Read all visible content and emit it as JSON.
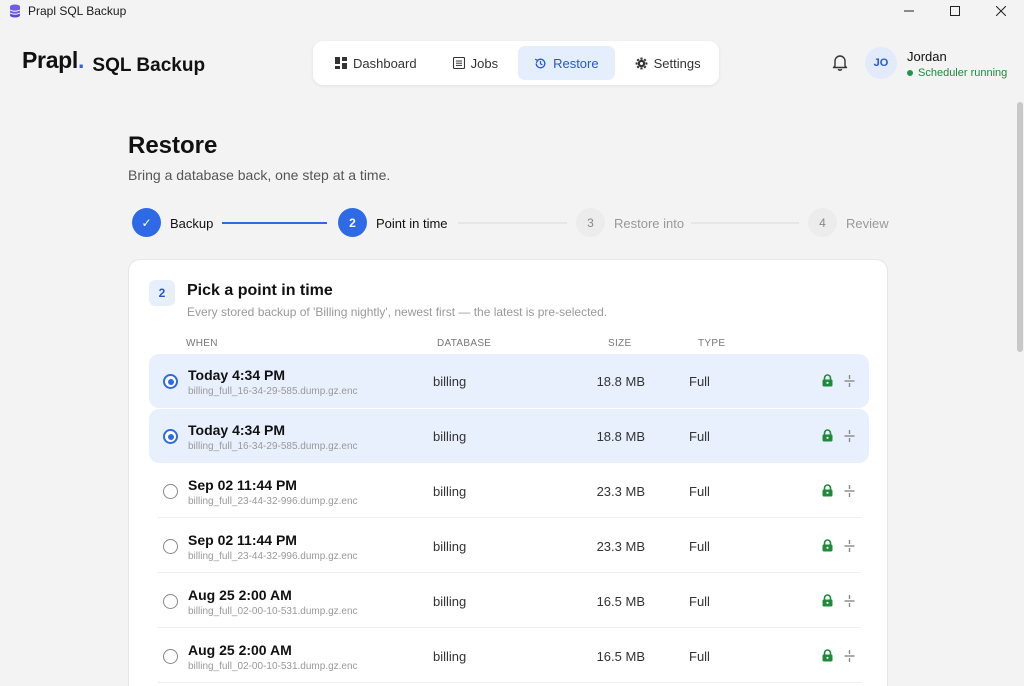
{
  "window": {
    "title": "Prapl SQL Backup"
  },
  "brand": {
    "name": "Prapl",
    "dot": ".",
    "product": "SQL Backup"
  },
  "nav": [
    {
      "label": "Dashboard",
      "icon": "dashboard-icon"
    },
    {
      "label": "Jobs",
      "icon": "jobs-icon"
    },
    {
      "label": "Restore",
      "icon": "restore-icon",
      "active": true
    },
    {
      "label": "Settings",
      "icon": "gear-icon"
    }
  ],
  "user": {
    "initials": "JO",
    "name": "Jordan",
    "status": "Scheduler running"
  },
  "page": {
    "title": "Restore",
    "subtitle": "Bring a database back, one step at a time."
  },
  "steps": [
    {
      "mark": "✓",
      "label": "Backup",
      "state": "done"
    },
    {
      "mark": "2",
      "label": "Point in time",
      "state": "current"
    },
    {
      "mark": "3",
      "label": "Restore into",
      "state": "todo"
    },
    {
      "mark": "4",
      "label": "Review",
      "state": "todo"
    }
  ],
  "card": {
    "badge": "2",
    "title": "Pick a point in time",
    "subtitle": "Every stored backup of 'Billing nightly', newest first — the latest is pre-selected.",
    "columns": {
      "when": "WHEN",
      "database": "DATABASE",
      "size": "SIZE",
      "type": "TYPE"
    },
    "rows": [
      {
        "when": "Today 4:34 PM",
        "file": "billing_full_16-34-29-585.dump.gz.enc",
        "database": "billing",
        "size": "18.8 MB",
        "type": "Full",
        "selected": true
      },
      {
        "when": "Today 4:34 PM",
        "file": "billing_full_16-34-29-585.dump.gz.enc",
        "database": "billing",
        "size": "18.8 MB",
        "type": "Full",
        "selected": true
      },
      {
        "when": "Sep 02 11:44 PM",
        "file": "billing_full_23-44-32-996.dump.gz.enc",
        "database": "billing",
        "size": "23.3 MB",
        "type": "Full",
        "selected": false
      },
      {
        "when": "Sep 02 11:44 PM",
        "file": "billing_full_23-44-32-996.dump.gz.enc",
        "database": "billing",
        "size": "23.3 MB",
        "type": "Full",
        "selected": false
      },
      {
        "when": "Aug 25 2:00 AM",
        "file": "billing_full_02-00-10-531.dump.gz.enc",
        "database": "billing",
        "size": "16.5 MB",
        "type": "Full",
        "selected": false
      },
      {
        "when": "Aug 25 2:00 AM",
        "file": "billing_full_02-00-10-531.dump.gz.enc",
        "database": "billing",
        "size": "16.5 MB",
        "type": "Full",
        "selected": false
      }
    ]
  },
  "colors": {
    "accent": "#2e6ae6",
    "status_green": "#1c8a3e",
    "lock_green": "#1f8a3b"
  }
}
